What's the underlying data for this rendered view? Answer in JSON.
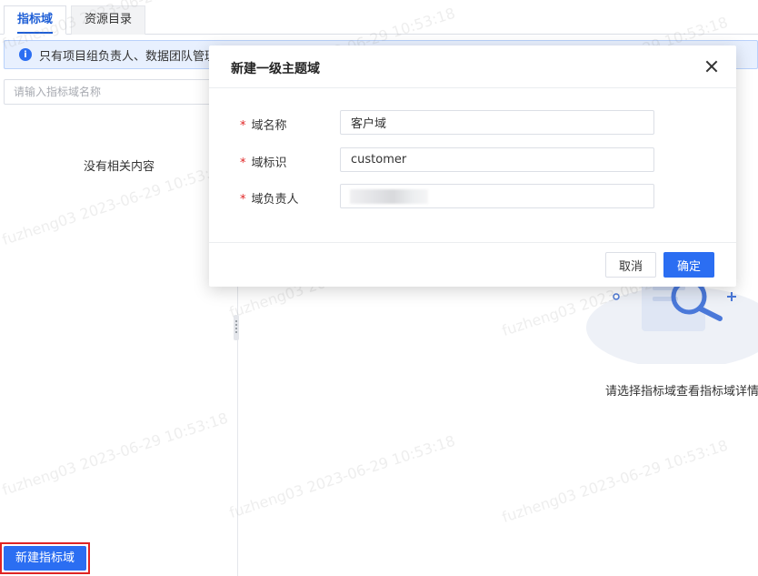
{
  "tabs": [
    {
      "label": "指标域",
      "active": true
    },
    {
      "label": "资源目录",
      "active": false
    }
  ],
  "notice": {
    "icon": "info-icon",
    "text": "只有项目组负责人、数据团队管理者"
  },
  "sidebar": {
    "search_placeholder": "请输入指标域名称",
    "empty_text": "没有相关内容",
    "new_button_label": "新建指标域"
  },
  "main": {
    "empty_text": "请选择指标域查看指标域详情"
  },
  "watermark": "fuzheng03 2023-06-29 10:53:18",
  "modal": {
    "title": "新建一级主题域",
    "fields": [
      {
        "label": "域名称",
        "value": "客户域",
        "required": true
      },
      {
        "label": "域标识",
        "value": "customer",
        "required": true
      },
      {
        "label": "域负责人",
        "value": "",
        "required": true
      }
    ],
    "cancel_label": "取消",
    "ok_label": "确定"
  },
  "colors": {
    "primary": "#2b6ef2",
    "required": "#e02424",
    "highlight_border": "#e02424"
  }
}
